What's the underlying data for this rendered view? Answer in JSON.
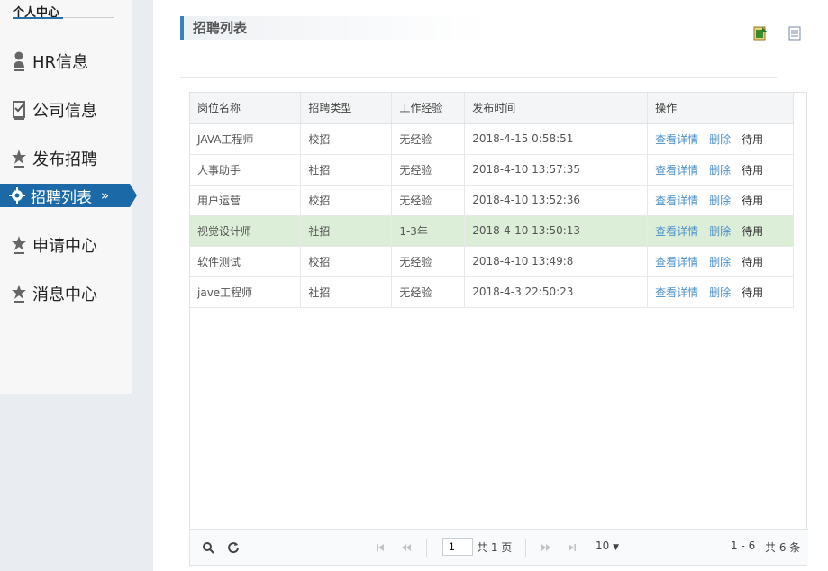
{
  "sidebar": {
    "title": "个人中心",
    "items": [
      {
        "label": "HR信息",
        "icon": "person-icon"
      },
      {
        "label": "公司信息",
        "icon": "checklist-icon"
      },
      {
        "label": "发布招聘",
        "icon": "star-icon"
      },
      {
        "label": "招聘列表",
        "icon": "gear-icon",
        "active": true,
        "arrow": "»"
      },
      {
        "label": "申请中心",
        "icon": "star-icon"
      },
      {
        "label": "消息中心",
        "icon": "star-icon"
      }
    ]
  },
  "header": {
    "title": "招聘列表",
    "tools": [
      "export-excel-icon",
      "document-icon"
    ]
  },
  "table": {
    "columns": [
      "岗位名称",
      "招聘类型",
      "工作经验",
      "发布时间",
      "操作"
    ],
    "rows": [
      {
        "name": "JAVA工程师",
        "type": "校招",
        "exp": "无经验",
        "time": "2018-4-15 0:58:51",
        "highlight": false
      },
      {
        "name": "人事助手",
        "type": "社招",
        "exp": "无经验",
        "time": "2018-4-10 13:57:35",
        "highlight": false
      },
      {
        "name": "用户运营",
        "type": "校招",
        "exp": "无经验",
        "time": "2018-4-10 13:52:36",
        "highlight": false
      },
      {
        "name": "视觉设计师",
        "type": "社招",
        "exp": "1-3年",
        "time": "2018-4-10 13:50:13",
        "highlight": true
      },
      {
        "name": "软件测试",
        "type": "校招",
        "exp": "无经验",
        "time": "2018-4-10 13:49:8",
        "highlight": false
      },
      {
        "name": "jave工程师",
        "type": "社招",
        "exp": "无经验",
        "time": "2018-4-3 22:50:23",
        "highlight": false
      }
    ],
    "actions": {
      "detail": "查看详情",
      "delete": "删除",
      "disable": "待用"
    }
  },
  "pager": {
    "page": "1",
    "total_pages": "共 1 页",
    "page_size": "10",
    "range": "1 - 6",
    "total_items": "共 6 条"
  },
  "colors": {
    "accent": "#1b6aa7",
    "link": "#4a90c8",
    "highlight_row": "#ddeed8"
  }
}
